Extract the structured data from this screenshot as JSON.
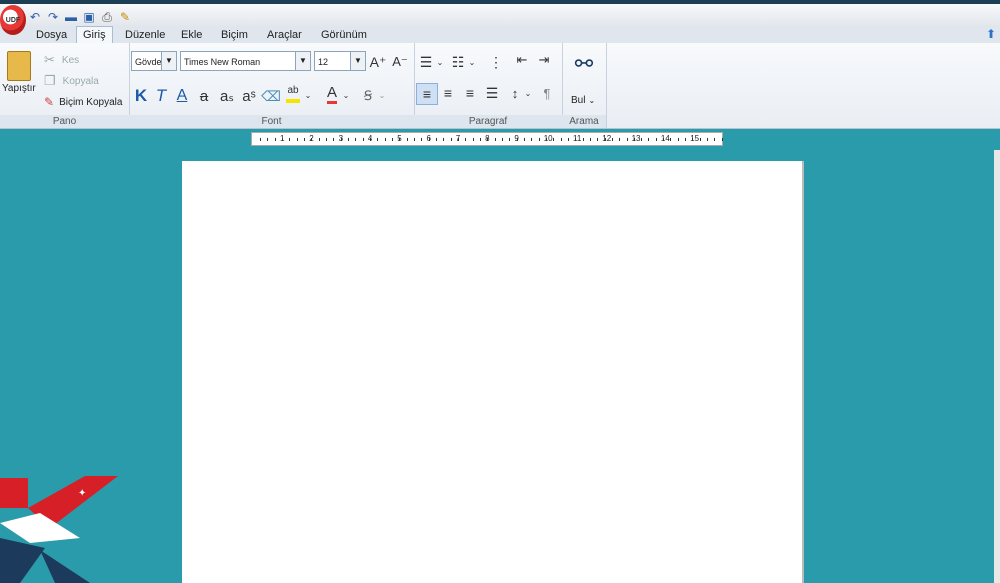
{
  "app": {
    "logo_text": "UDF"
  },
  "tabs": [
    {
      "label": "Dosya"
    },
    {
      "label": "Giriş",
      "active": true
    },
    {
      "label": "Düzenle"
    },
    {
      "label": "Ekle"
    },
    {
      "label": "Biçim"
    },
    {
      "label": "Araçlar"
    },
    {
      "label": "Görünüm"
    }
  ],
  "pano": {
    "paste": "Yapıştır",
    "cut": "Kes",
    "copy": "Kopyala",
    "format_painter": "Biçim Kopyala",
    "group_label": "Pano"
  },
  "font": {
    "style_value": "Gövde",
    "family_value": "Times New Roman",
    "size_value": "12",
    "group_label": "Font"
  },
  "paragraph": {
    "group_label": "Paragraf"
  },
  "search": {
    "find": "Bul",
    "group_label": "Arama"
  },
  "ruler": {
    "numbers": [
      "1",
      "2",
      "3",
      "4",
      "5",
      "6",
      "7",
      "8",
      "9",
      "10",
      "11",
      "12",
      "13",
      "14",
      "15"
    ]
  },
  "colors": {
    "background": "#2a9bab",
    "accent": "#2f73c5",
    "font_color_bar": "#e53935",
    "highlight_bar": "#f5e400"
  }
}
